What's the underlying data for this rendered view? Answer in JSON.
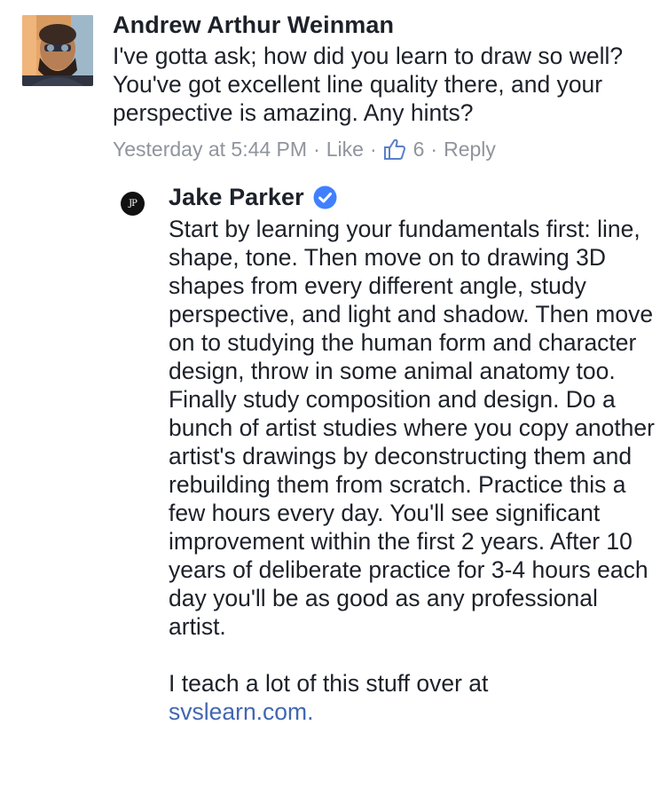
{
  "comment": {
    "author": "Andrew Arthur Weinman",
    "text": "I've gotta ask; how did you learn to draw so well? You've got excellent line quality there, and your perspective is amazing. Any hints?",
    "timestamp": "Yesterday at 5:44 PM",
    "separator": "·",
    "like_label": "Like",
    "like_count": "6",
    "reply_label": "Reply",
    "avatar_icon": "user-avatar",
    "like_icon": "thumbs-up-icon"
  },
  "reply": {
    "author": "Jake Parker",
    "verified_icon": "verified-badge-icon",
    "avatar_initials": "JP",
    "paragraph1": "Start by learning your fundamentals first: line, shape, tone. Then move on to drawing 3D shapes from every different angle, study perspective, and light and shadow. Then move on to studying the human form and character design, throw in some animal anatomy too. Finally study composition and design. Do a bunch of artist studies where you copy another artist's drawings by deconstructing them and rebuilding them from scratch. Practice this a few hours every day. You'll see significant improvement within the first 2 years. After 10 years of deliberate practice for 3-4 hours each day you'll be as good as any professional artist.",
    "paragraph2_text": "I teach a lot of this stuff over at",
    "link_text": "svslearn.com."
  },
  "colors": {
    "text": "#1d2129",
    "meta": "#90949c",
    "link": "#4267b2",
    "verified": "#4080ff"
  }
}
